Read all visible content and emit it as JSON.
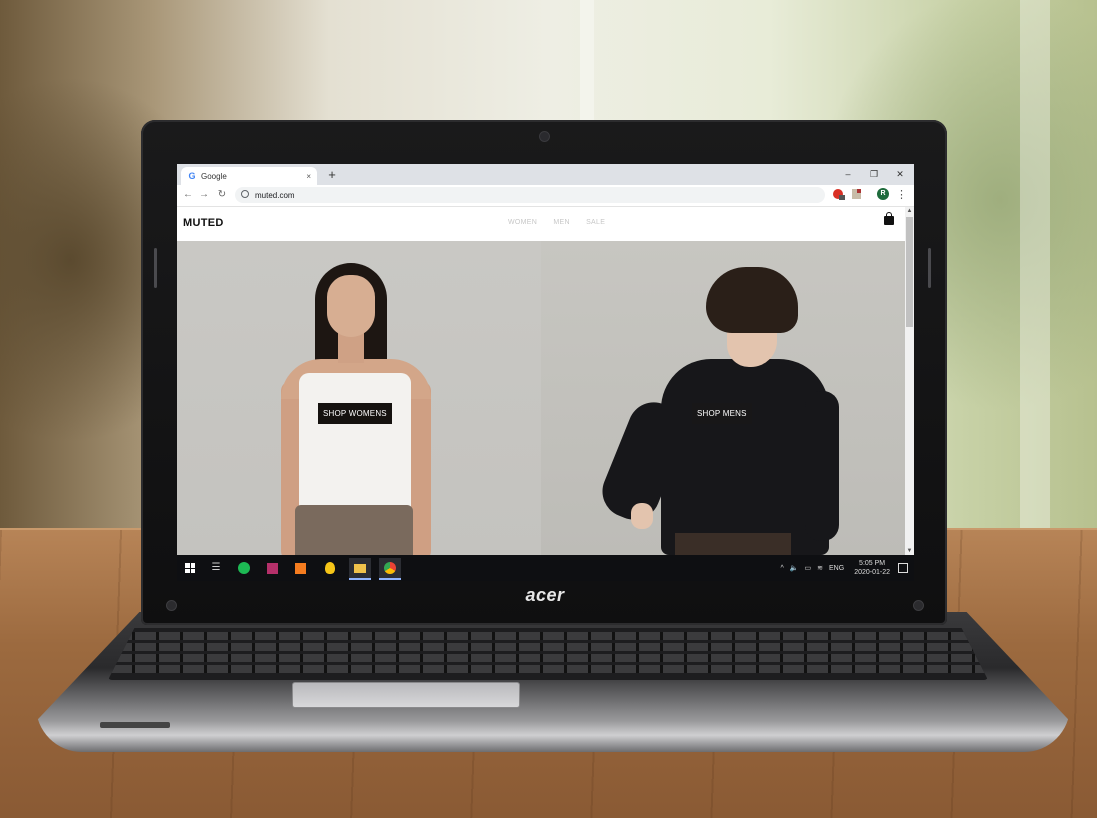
{
  "browser": {
    "tab_title": "Google",
    "tab_icon": "G",
    "tab_close": "×",
    "new_tab": "+",
    "window_controls": [
      "–",
      "❐",
      "✕"
    ],
    "url": "muted.com",
    "profile_initial": "R"
  },
  "site": {
    "logo": "MUTED",
    "nav": [
      "WOMEN",
      "MEN",
      "SALE"
    ],
    "shop_womens": "SHOP WOMENS",
    "shop_mens": "SHOP MENS"
  },
  "taskbar": {
    "language": "ENG",
    "time": "5:05 PM",
    "date": "2020-01-22"
  },
  "laptop": {
    "brand": "acer"
  },
  "colors": {
    "accent_profile": "#1e6b3c",
    "shop_button_bg": "#15120f",
    "nav_text": "#c7c7c7"
  }
}
